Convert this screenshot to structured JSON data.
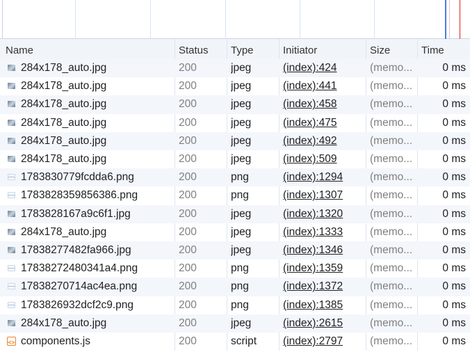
{
  "columns": {
    "name": "Name",
    "status": "Status",
    "type": "Type",
    "initiator": "Initiator",
    "size": "Size",
    "time": "Time"
  },
  "requests": [
    {
      "name": "284x178_auto.jpg",
      "status": "200",
      "type": "jpeg",
      "initiator": "(index):424",
      "size": "(memo...",
      "time": "0 ms",
      "icon": "image-thumbnail-icon"
    },
    {
      "name": "284x178_auto.jpg",
      "status": "200",
      "type": "jpeg",
      "initiator": "(index):441",
      "size": "(memo...",
      "time": "0 ms",
      "icon": "image-thumbnail-icon"
    },
    {
      "name": "284x178_auto.jpg",
      "status": "200",
      "type": "jpeg",
      "initiator": "(index):458",
      "size": "(memo...",
      "time": "0 ms",
      "icon": "image-thumbnail-icon"
    },
    {
      "name": "284x178_auto.jpg",
      "status": "200",
      "type": "jpeg",
      "initiator": "(index):475",
      "size": "(memo...",
      "time": "0 ms",
      "icon": "image-thumbnail-icon"
    },
    {
      "name": "284x178_auto.jpg",
      "status": "200",
      "type": "jpeg",
      "initiator": "(index):492",
      "size": "(memo...",
      "time": "0 ms",
      "icon": "image-thumbnail-icon"
    },
    {
      "name": "284x178_auto.jpg",
      "status": "200",
      "type": "jpeg",
      "initiator": "(index):509",
      "size": "(memo...",
      "time": "0 ms",
      "icon": "image-thumbnail-icon"
    },
    {
      "name": "1783830779fcdda6.png",
      "status": "200",
      "type": "png",
      "initiator": "(index):1294",
      "size": "(memo...",
      "time": "0 ms",
      "icon": "image-thumbnail-icon"
    },
    {
      "name": "1783828359856386.png",
      "status": "200",
      "type": "png",
      "initiator": "(index):1307",
      "size": "(memo...",
      "time": "0 ms",
      "icon": "image-thumbnail-icon"
    },
    {
      "name": "1783828167a9c6f1.jpg",
      "status": "200",
      "type": "jpeg",
      "initiator": "(index):1320",
      "size": "(memo...",
      "time": "0 ms",
      "icon": "image-thumbnail-icon"
    },
    {
      "name": "284x178_auto.jpg",
      "status": "200",
      "type": "jpeg",
      "initiator": "(index):1333",
      "size": "(memo...",
      "time": "0 ms",
      "icon": "image-thumbnail-icon"
    },
    {
      "name": "17838277482fa966.jpg",
      "status": "200",
      "type": "jpeg",
      "initiator": "(index):1346",
      "size": "(memo...",
      "time": "0 ms",
      "icon": "image-thumbnail-icon"
    },
    {
      "name": "17838272480341a4.png",
      "status": "200",
      "type": "png",
      "initiator": "(index):1359",
      "size": "(memo...",
      "time": "0 ms",
      "icon": "image-thumbnail-icon"
    },
    {
      "name": "17838270714ac4ea.png",
      "status": "200",
      "type": "png",
      "initiator": "(index):1372",
      "size": "(memo...",
      "time": "0 ms",
      "icon": "image-thumbnail-icon"
    },
    {
      "name": "1783826932dcf2c9.png",
      "status": "200",
      "type": "png",
      "initiator": "(index):1385",
      "size": "(memo...",
      "time": "0 ms",
      "icon": "image-thumbnail-icon"
    },
    {
      "name": "284x178_auto.jpg",
      "status": "200",
      "type": "jpeg",
      "initiator": "(index):2615",
      "size": "(memo...",
      "time": "0 ms",
      "icon": "image-thumbnail-icon"
    },
    {
      "name": "components.js",
      "status": "200",
      "type": "script",
      "initiator": "(index):2797",
      "size": "(memo...",
      "time": "0 ms",
      "icon": "script-file-icon"
    }
  ],
  "colors": {
    "header_bg": "#f1f4f9",
    "alt_row_bg": "#f3f6fb",
    "timeline_marker_blue": "#4a7bd6",
    "timeline_marker_red": "#dd2222",
    "script_icon": "#e8852a"
  }
}
